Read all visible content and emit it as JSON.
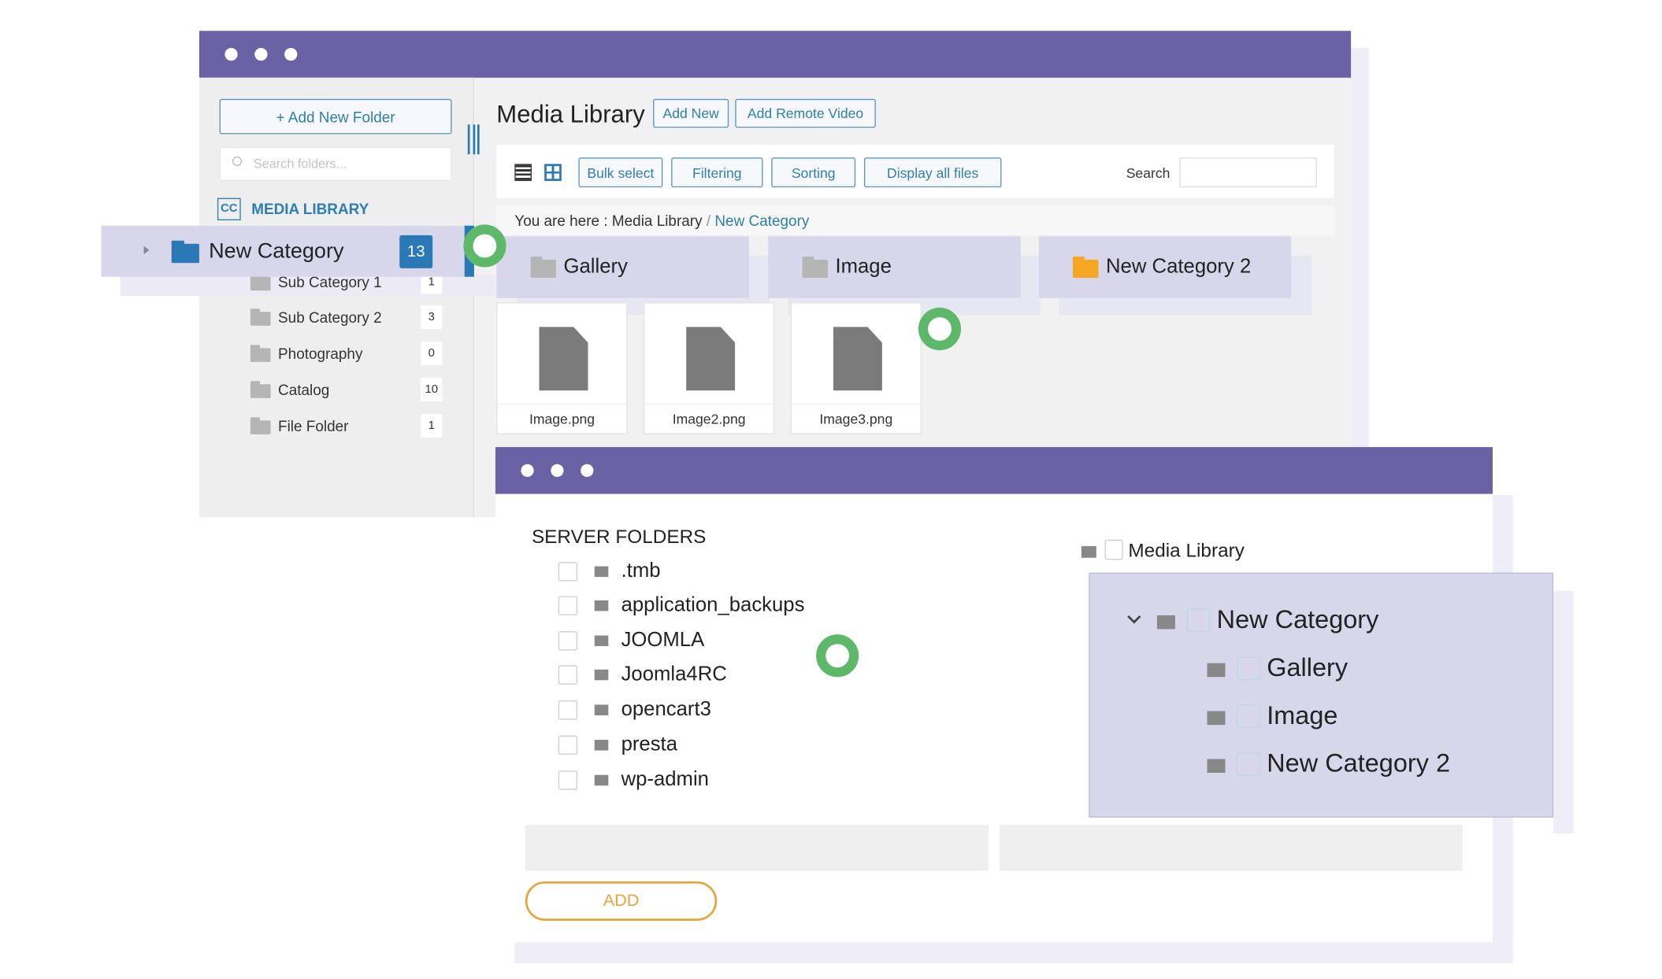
{
  "colors": {
    "titlebar": "#6a62a5",
    "accent": "#2a78b5",
    "highlight": "#d7d6eb",
    "drag_indicator": "#5eb86a",
    "add_button": "#e8a33d",
    "folder_orange": "#f5a623"
  },
  "library_window": {
    "sidebar": {
      "add_folder_label": "+ Add New Folder",
      "search_placeholder": "Search folders...",
      "root_label": "MEDIA LIBRARY",
      "selected": {
        "label": "New Category",
        "count": "13"
      },
      "items": [
        {
          "label": "Sub Category 1",
          "count": "1"
        },
        {
          "label": "Sub Category 2",
          "count": "3"
        },
        {
          "label": "Photography",
          "count": "0"
        },
        {
          "label": "Catalog",
          "count": "10"
        },
        {
          "label": "File Folder",
          "count": "1"
        }
      ]
    },
    "main": {
      "title": "Media Library",
      "add_new": "Add New",
      "add_remote_video": "Add Remote Video",
      "toolbar": {
        "bulk_select": "Bulk select",
        "filtering": "Filtering",
        "sorting": "Sorting",
        "display_all": "Display all files",
        "search_label": "Search",
        "search_value": ""
      },
      "breadcrumb": {
        "prefix": "You are here",
        "sep": ":",
        "root": "Media Library",
        "slash": "/",
        "current": "New Category"
      },
      "folders": [
        {
          "label": "Gallery",
          "icon": "folder-gray"
        },
        {
          "label": "Image",
          "icon": "folder-gray"
        },
        {
          "label": "New Category 2",
          "icon": "folder-orange"
        }
      ],
      "files": [
        {
          "label": "Image.png"
        },
        {
          "label": "Image2.png"
        },
        {
          "label": "Image3.png"
        }
      ]
    }
  },
  "import_window": {
    "server_title": "SERVER FOLDERS",
    "server_folders": [
      ".tmb",
      "application_backups",
      "JOOMLA",
      "Joomla4RC",
      "opencart3",
      "presta",
      "wp-admin"
    ],
    "tree_root": "Media Library",
    "tree_parent": "New Category",
    "tree_children": [
      "Gallery",
      "Image",
      "New Category 2"
    ],
    "add_label": "ADD"
  }
}
